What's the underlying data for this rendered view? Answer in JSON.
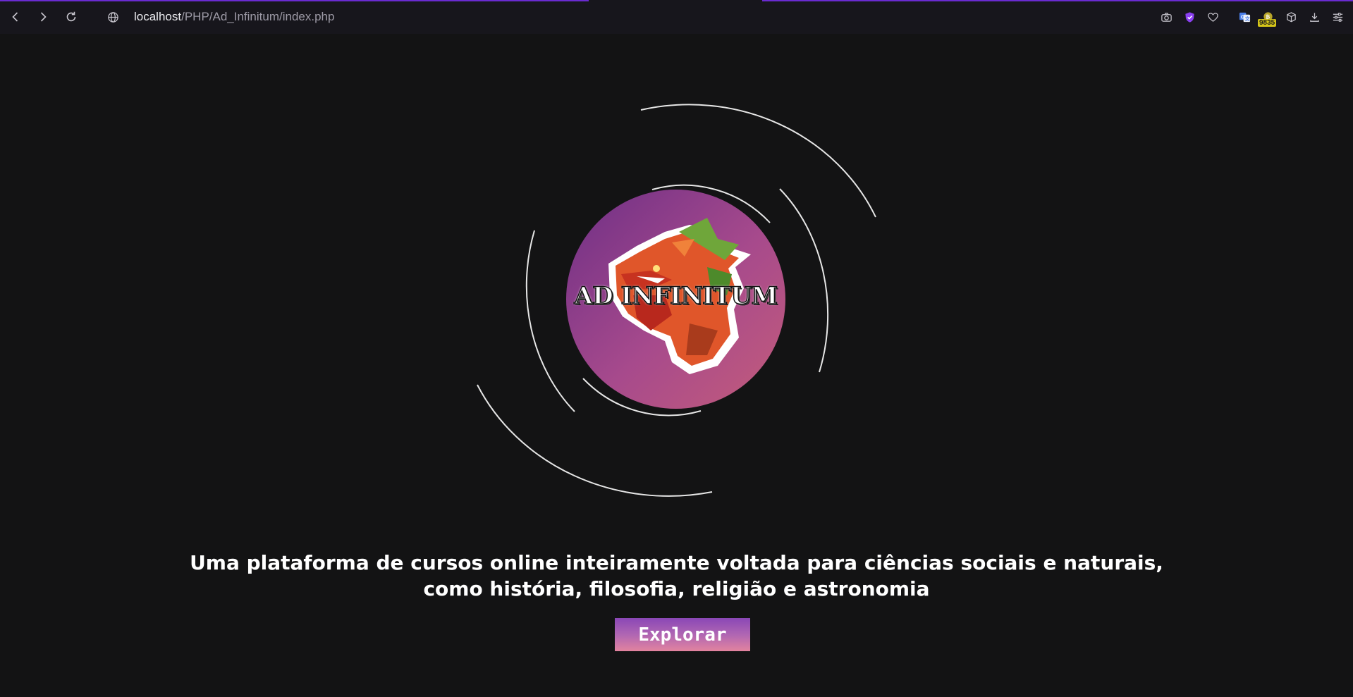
{
  "browser": {
    "url_host": "localhost",
    "url_path": "/PHP/Ad_Infinitum/index.php",
    "toolbar_icons": [
      "camera-icon",
      "shield-check-icon",
      "heart-icon",
      "translate-icon",
      "wallet-icon",
      "cube-icon",
      "download-icon",
      "sliders-icon"
    ],
    "wallet_badge": "9835",
    "accent_color": "#6a2bd0"
  },
  "hero": {
    "logo_text": "AD INFINITUM",
    "tagline_line1": "Uma plataforma de cursos online inteiramente voltada para ciências sociais e naturais,",
    "tagline_line2": "como história, filosofia, religião e astronomia",
    "explore_label": "Explorar",
    "logo_gradient": [
      "#6e2f86",
      "#c45c7a"
    ]
  }
}
